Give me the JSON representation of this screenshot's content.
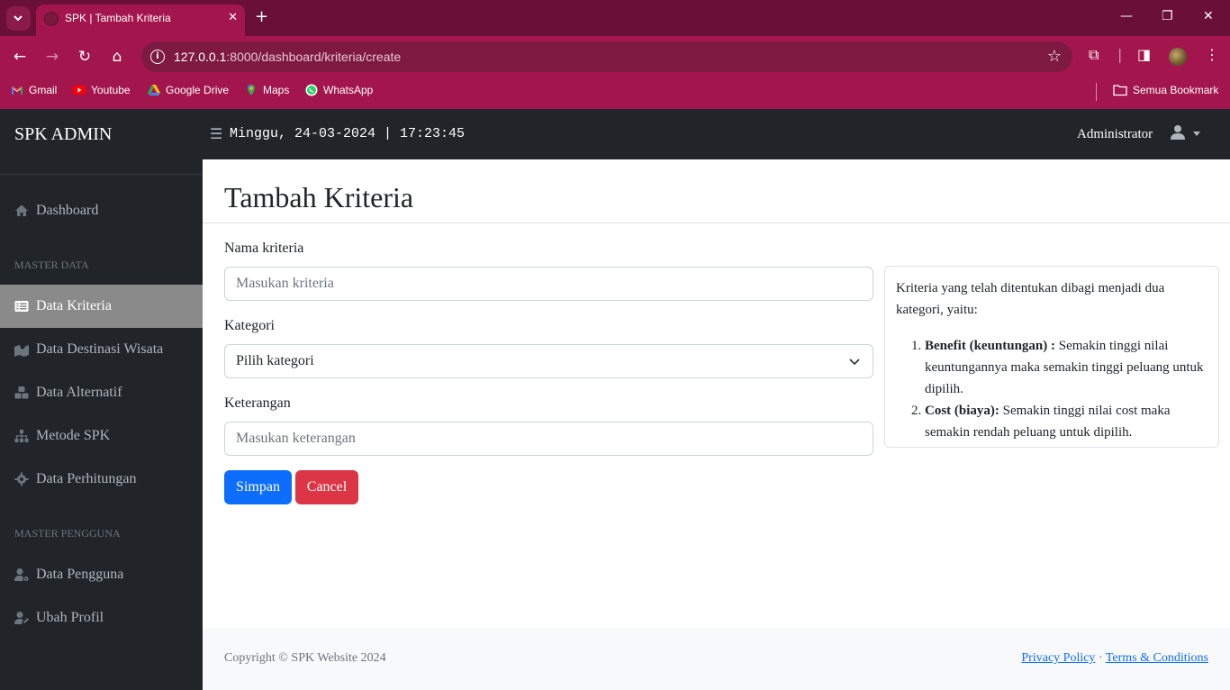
{
  "browser": {
    "tab_title": "SPK | Tambah Kriteria",
    "url_host": "127.0.0.1",
    "url_rest": ":8000/dashboard/kriteria/create",
    "bookmarks": [
      "Gmail",
      "Youtube",
      "Google Drive",
      "Maps",
      "WhatsApp"
    ],
    "all_bookmarks": "Semua Bookmark"
  },
  "topnav": {
    "brand": "SPK ADMIN",
    "clock": "Minggu, 24-03-2024 | 17:23:45",
    "user": "Administrator"
  },
  "sidebar": {
    "dashboard": "Dashboard",
    "heading_master_data": "MASTER DATA",
    "items_master": [
      "Data Kriteria",
      "Data Destinasi Wisata",
      "Data Alternatif",
      "Metode SPK",
      "Data Perhitungan"
    ],
    "heading_master_pengguna": "MASTER PENGGUNA",
    "items_pengguna": [
      "Data Pengguna",
      "Ubah Profil"
    ]
  },
  "main": {
    "title": "Tambah Kriteria",
    "form": {
      "nama_label": "Nama kriteria",
      "nama_placeholder": "Masukan kriteria",
      "kategori_label": "Kategori",
      "kategori_value": "Pilih kategori",
      "keterangan_label": "Keterangan",
      "keterangan_placeholder": "Masukan keterangan",
      "save": "Simpan",
      "cancel": "Cancel"
    },
    "info": {
      "intro": "Kriteria yang telah ditentukan dibagi menjadi dua kategori, yaitu:",
      "benefit_title": "Benefit (keuntungan) :",
      "benefit_text": " Semakin tinggi nilai keuntungannya maka semakin tinggi peluang untuk dipilih.",
      "cost_title": "Cost (biaya):",
      "cost_text": " Semakin tinggi nilai cost maka semakin rendah peluang untuk dipilih."
    }
  },
  "footer": {
    "copyright": "Copyright © SPK Website 2024",
    "privacy": "Privacy Policy",
    "separator": "·",
    "terms": "Terms & Conditions"
  },
  "colors": {
    "chrome_tab": "#6a0f36",
    "chrome_bar": "#a3154d",
    "dark": "#212529",
    "primary": "#0d6efd",
    "danger": "#dc3545",
    "active_item": "#8a8a8a"
  }
}
